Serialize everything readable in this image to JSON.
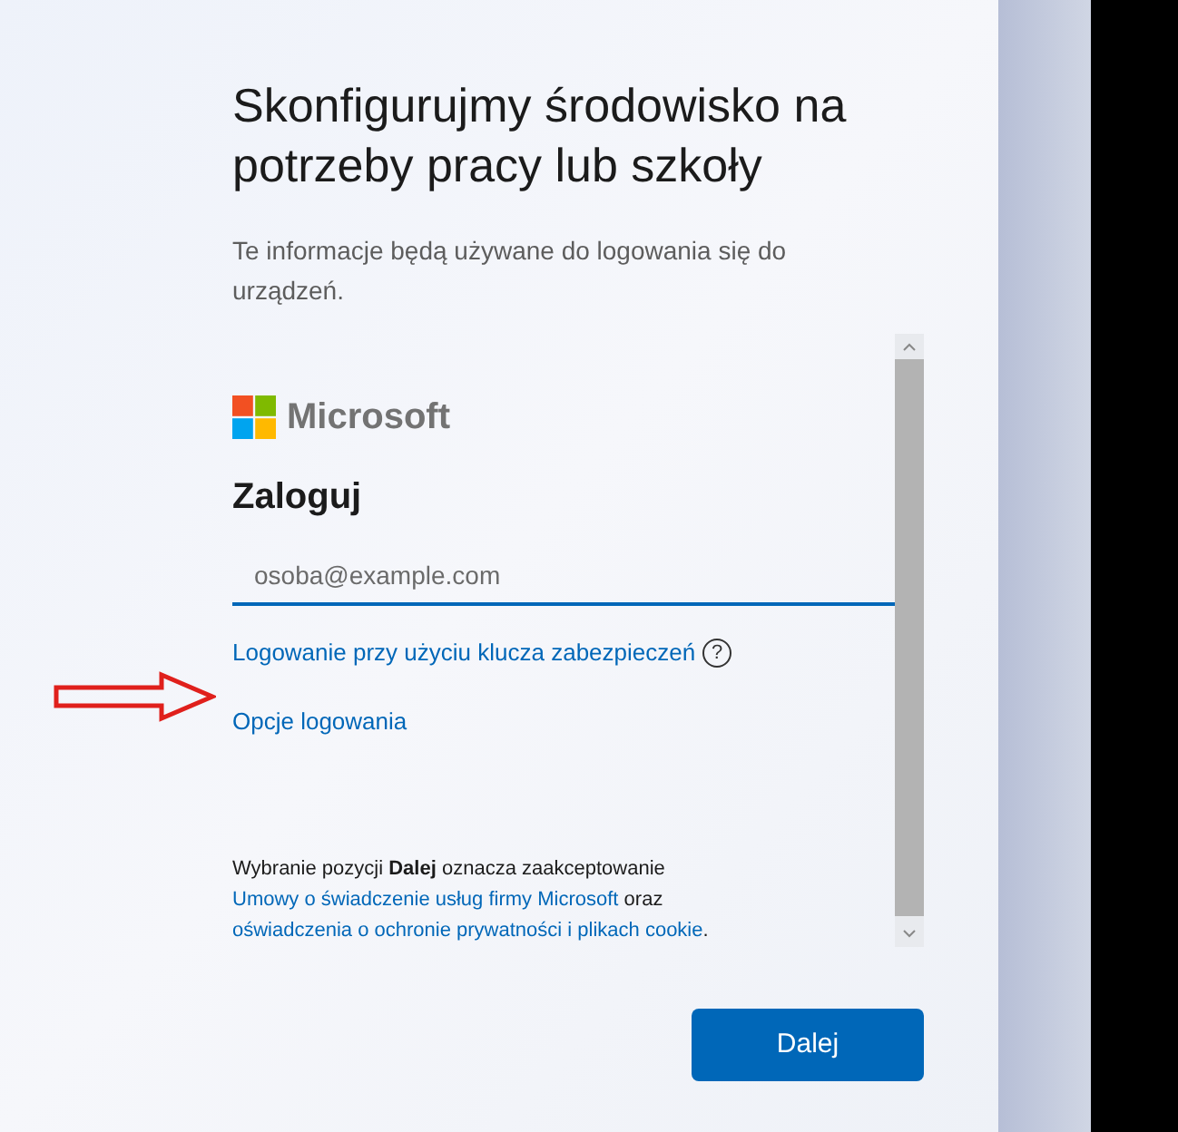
{
  "heading": "Skonfigurujmy środowisko na potrzeby pracy lub szkoły",
  "subtitle": "Te informacje będą używane do logowania się do urządzeń.",
  "sign_in": {
    "brand": "Microsoft",
    "title": "Zaloguj",
    "email": {
      "placeholder": "osoba@example.com"
    },
    "security_key_link": "Logowanie przy użyciu klucza zabezpieczeń",
    "help": "?",
    "options_link": "Opcje logowania",
    "terms": [
      {
        "kind": "text",
        "text": "Wybranie pozycji "
      },
      {
        "kind": "bold",
        "text": "Dalej"
      },
      {
        "kind": "text",
        "text": " oznacza zaakceptowanie "
      },
      {
        "kind": "link",
        "text": "Umowy o świadczenie usług firmy Microsoft"
      },
      {
        "kind": "text",
        "text": " oraz "
      },
      {
        "kind": "link",
        "text": "oświadczenia o ochronie prywatności i plikach cookie"
      },
      {
        "kind": "text",
        "text": "."
      }
    ]
  },
  "next_button": "Dalej"
}
